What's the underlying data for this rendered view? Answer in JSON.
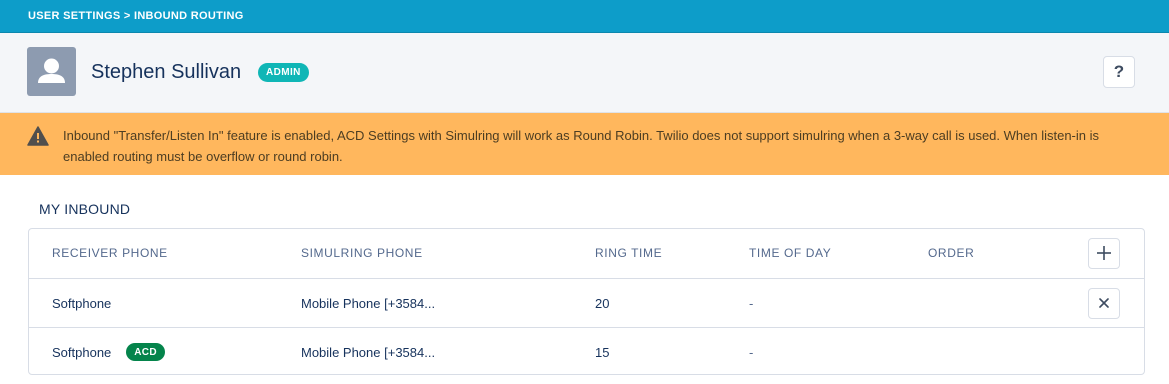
{
  "breadcrumb": {
    "text": "USER SETTINGS > INBOUND ROUTING"
  },
  "header": {
    "user_name": "Stephen Sullivan",
    "role_badge": "ADMIN",
    "help_label": "?"
  },
  "warning": {
    "icon": "warning-icon",
    "text": "Inbound \"Transfer/Listen In\" feature is enabled, ACD Settings with Simulring will work as Round Robin. Twilio does not support simulring when a 3-way call is used. When listen-in is enabled routing must be overflow or round robin."
  },
  "section": {
    "title": "MY INBOUND"
  },
  "table": {
    "columns": [
      "RECEIVER PHONE",
      "SIMULRING PHONE",
      "RING TIME",
      "TIME OF DAY",
      "ORDER"
    ],
    "add_icon": "plus-icon",
    "remove_icon": "close-icon",
    "rows": [
      {
        "receiver": "Softphone",
        "badge": "",
        "simulring": "Mobile Phone [+3584...",
        "ring_time": "20",
        "time_of_day": "-",
        "order": ""
      },
      {
        "receiver": "Softphone",
        "badge": "ACD",
        "simulring": "Mobile Phone [+3584...",
        "ring_time": "15",
        "time_of_day": "-",
        "order": ""
      }
    ]
  },
  "colors": {
    "breadcrumb_bg": "#0d9dc9",
    "admin_badge": "#0fb6b6",
    "warning_bg": "#ffb75d",
    "acd_badge": "#04844b",
    "text_primary": "#16325c"
  }
}
